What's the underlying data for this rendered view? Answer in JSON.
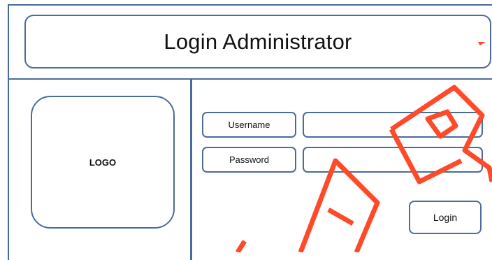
{
  "header": {
    "title": "Login Administrator"
  },
  "logo": {
    "text": "LOGO"
  },
  "form": {
    "username_label": "Username",
    "password_label": "Password",
    "username_value": "",
    "password_value": "",
    "login_label": "Login"
  },
  "colors": {
    "border": "#4a6c9b",
    "watermark": "#ff4a2a"
  }
}
